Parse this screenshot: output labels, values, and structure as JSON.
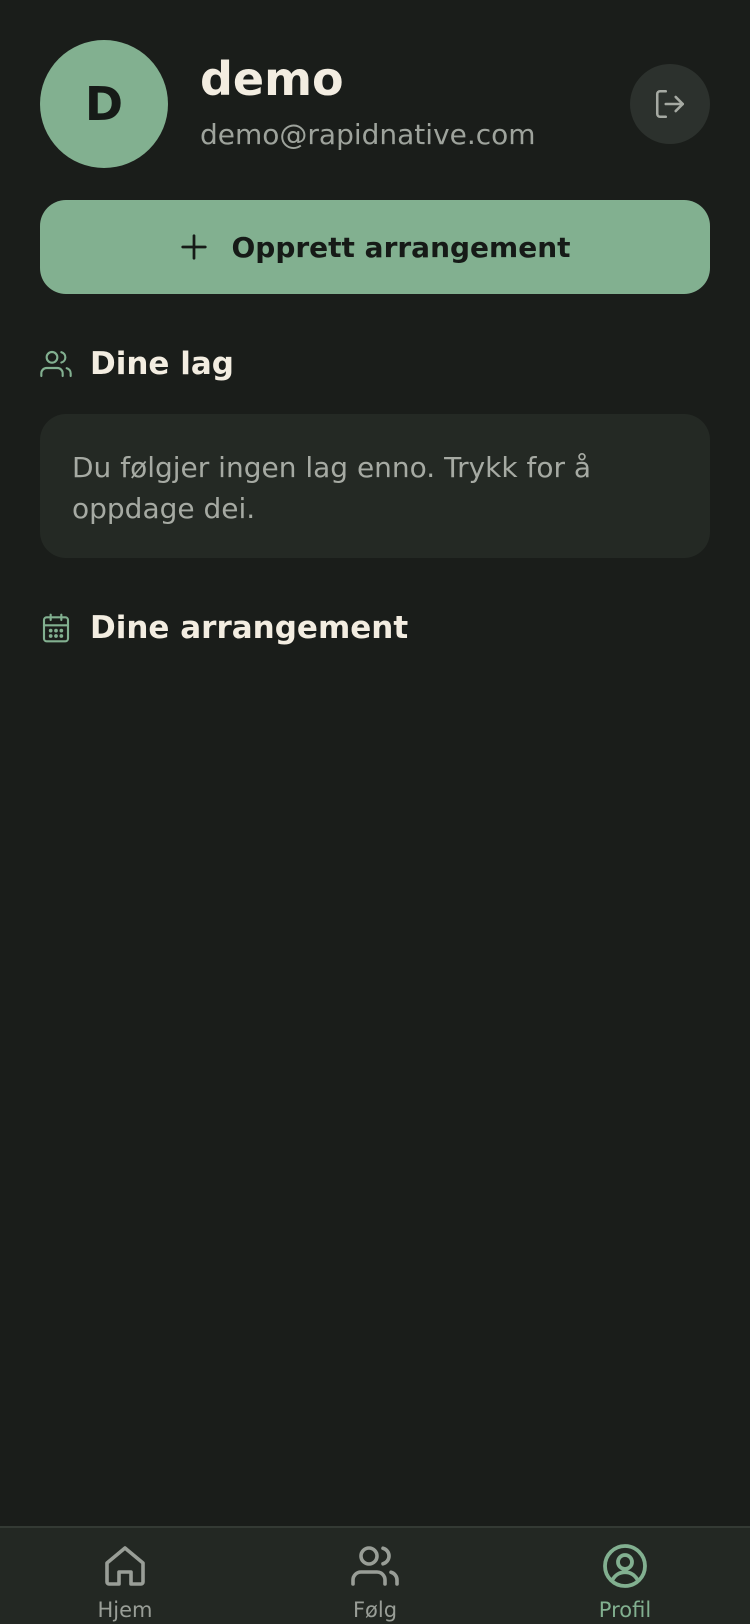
{
  "profile": {
    "avatar_initial": "D",
    "name": "demo",
    "email": "demo@rapidnative.com"
  },
  "actions": {
    "create_event_label": "Opprett arrangement"
  },
  "sections": {
    "teams": {
      "title": "Dine lag",
      "empty_text": "Du følgjer ingen lag enno. Trykk for å oppdage dei."
    },
    "events": {
      "title": "Dine arrangement"
    }
  },
  "tab_bar": {
    "items": [
      {
        "label": "Hjem",
        "icon": "home-icon",
        "active": false
      },
      {
        "label": "Følg",
        "icon": "users-icon",
        "active": false
      },
      {
        "label": "Profil",
        "icon": "user-circle-icon",
        "active": true
      }
    ]
  },
  "colors": {
    "background": "#1a1d1a",
    "accent": "#82b090",
    "card": "#242924",
    "text_primary": "#f3ede1",
    "text_secondary": "#9ea39c"
  }
}
